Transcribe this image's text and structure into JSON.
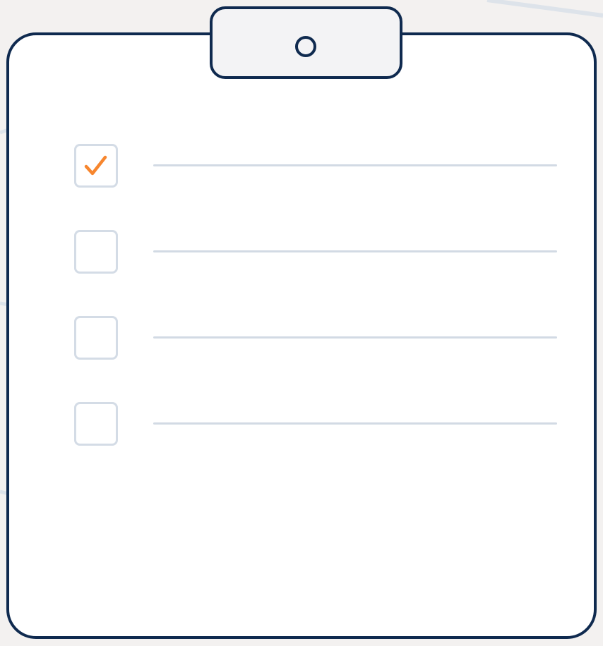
{
  "colors": {
    "background": "#f3f1f0",
    "board_fill": "#ffffff",
    "outline": "#0f2a4f",
    "clip_fill": "#f3f3f5",
    "checkbox_border": "#d4dce6",
    "line": "#d2dae4",
    "check_accent": "#f7862e"
  },
  "checklist": {
    "items": [
      {
        "checked": true,
        "icon": "checkmark-icon"
      },
      {
        "checked": false
      },
      {
        "checked": false
      },
      {
        "checked": false
      }
    ]
  }
}
